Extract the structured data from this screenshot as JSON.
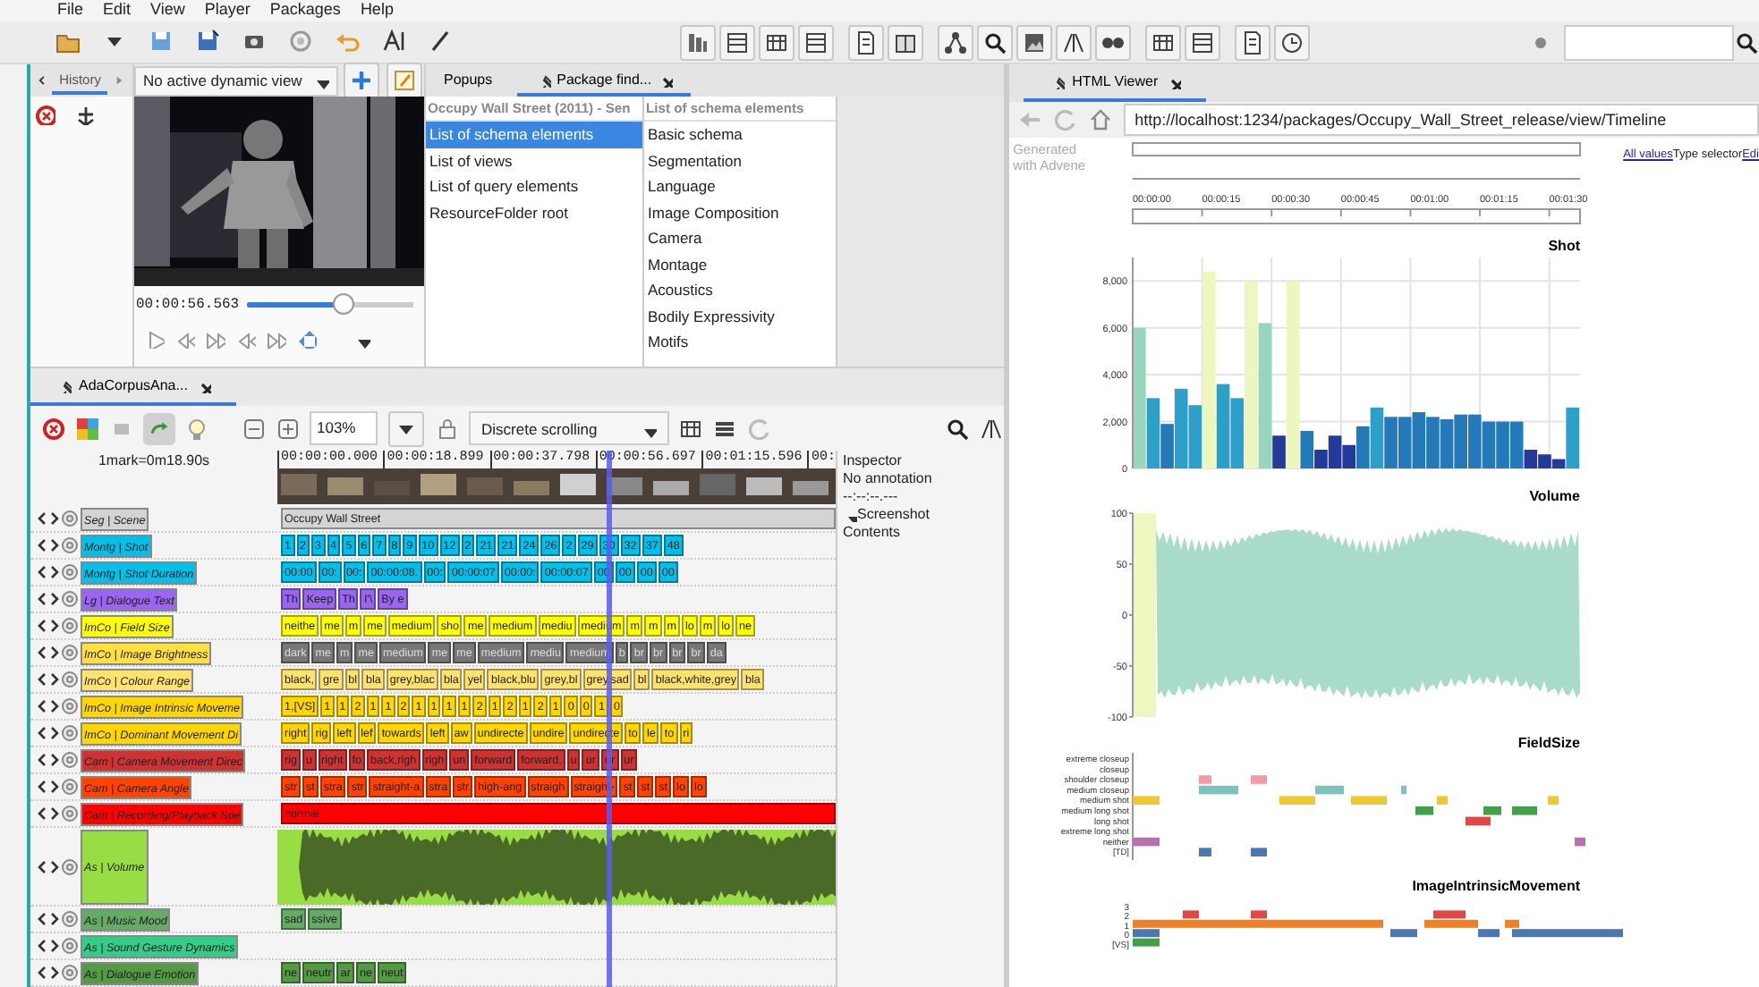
{
  "menu": [
    "File",
    "Edit",
    "View",
    "Player",
    "Packages",
    "Help"
  ],
  "history": {
    "tab": "History"
  },
  "video": {
    "view_selector": "No active dynamic view",
    "time": "00:00:56.563",
    "level": 0.6
  },
  "dock_tabs": [
    {
      "label": "Popups",
      "selected": false
    },
    {
      "label": "Package find...",
      "selected": true
    }
  ],
  "finder": {
    "columns": [
      {
        "header": "Occupy Wall Street (2011) - Sen",
        "items": [
          {
            "label": "List of schema elements",
            "selected": true
          },
          {
            "label": "List of views",
            "selected": false
          },
          {
            "label": "List of query elements",
            "selected": false
          },
          {
            "label": "ResourceFolder root",
            "selected": false
          }
        ]
      },
      {
        "header": "List of schema elements",
        "items": [
          {
            "label": "Basic schema",
            "selected": false
          },
          {
            "label": "Segmentation",
            "selected": false
          },
          {
            "label": "Language",
            "selected": false
          },
          {
            "label": "Image Composition",
            "selected": false
          },
          {
            "label": "Camera",
            "selected": false
          },
          {
            "label": "Montage",
            "selected": false
          },
          {
            "label": "Acoustics",
            "selected": false
          },
          {
            "label": "Bodily Expressivity",
            "selected": false
          },
          {
            "label": "Motifs",
            "selected": false
          }
        ]
      }
    ]
  },
  "timeline": {
    "tab": "AdaCorpusAna...",
    "zoom": "103%",
    "scroll_mode": "Discrete scrolling",
    "scale": "1mark=0m18.90s",
    "playhead": {
      "level": 0.59
    },
    "times": [
      "00:00:00.000",
      "00:00:18.899",
      "00:00:37.798",
      "00:00:56.697",
      "00:01:15.596",
      "00:"
    ],
    "inspector": {
      "title": "Inspector",
      "annotation": "No annotation",
      "time": "--:--:--.---",
      "section": "Screenshot",
      "contents": "Contents"
    },
    "tracks": [
      {
        "label": "Seg | Scene",
        "kind": "segments",
        "color": "#d4d4d4",
        "segments": [
          "Occupy Wall Street"
        ]
      },
      {
        "label": "Montg | Shot",
        "kind": "segments",
        "color": "#00bfe8",
        "segments": [
          "1",
          "2",
          "3",
          "4",
          "5",
          "6",
          "7",
          "8",
          "9",
          "10",
          "12",
          "2",
          "21",
          "21",
          "24",
          "26",
          "2",
          "29",
          "30",
          "32",
          "37",
          "48"
        ]
      },
      {
        "label": "Montg | Shot Duration",
        "kind": "segments",
        "color": "#00bfe8",
        "segments": [
          "00:00",
          "00:",
          "00:",
          "00:00:08.",
          "00:",
          "00:00:07",
          "00:00:",
          "00:00:07",
          "00",
          "00",
          "00",
          "00"
        ]
      },
      {
        "label": "Lg | Dialogue Text",
        "kind": "segments",
        "color": "#9966ee",
        "segments": [
          "Th",
          "Keep",
          "Th",
          "I'\\",
          "By e"
        ]
      },
      {
        "label": "ImCo | Field Size",
        "kind": "segments",
        "color": "#ffff00",
        "segments": [
          "neithe",
          "me",
          "m",
          "me",
          "medium",
          "sho",
          "me",
          "medium",
          "mediu",
          "medium",
          "m",
          "m",
          "m",
          "lo",
          "m",
          "lo",
          "ne"
        ]
      },
      {
        "label": "ImCo | Image Brightness",
        "kind": "dark_segments",
        "color": "#ffe040",
        "segments": [
          "dark",
          "me",
          "m",
          "me",
          "medium",
          "me",
          "me",
          "medium",
          "mediu",
          "medium",
          "b",
          "br",
          "br",
          "br",
          "br",
          "da"
        ]
      },
      {
        "label": "ImCo | Colour Range",
        "kind": "segments",
        "color": "#ffe270",
        "segments": [
          "black,",
          "gre",
          "bl",
          "bla",
          "grey,blac",
          "bla",
          "yel",
          "black,blu",
          "grey,bl",
          "grey,sad",
          "bl",
          "black,white,grey",
          "bla"
        ]
      },
      {
        "label": "ImCo | Image Intrinsic Moveme",
        "kind": "segments",
        "color": "#ffd700",
        "segments": [
          "1,[VS]",
          "1",
          "1",
          "2",
          "1",
          "1",
          "2",
          "1",
          "1",
          "1",
          "1",
          "2",
          "1",
          "2",
          "1",
          "2",
          "1",
          "0",
          "0",
          "1",
          "0"
        ]
      },
      {
        "label": "ImCo | Dominant Movement Di",
        "kind": "segments",
        "color": "#ffd700",
        "segments": [
          "right",
          "rig",
          "left",
          "lef",
          "towards",
          "left",
          "aw",
          "undirecte",
          "undire",
          "undirecte",
          "to",
          "le",
          "to",
          "ri"
        ]
      },
      {
        "label": "Cam | Camera Movement Direc",
        "kind": "segments",
        "color": "#cc3333",
        "segments": [
          "rig",
          "u",
          "right",
          "fo",
          "back,righ",
          "righ",
          "un",
          "forward",
          "forward,",
          "u",
          "ur",
          "ur",
          "ur"
        ]
      },
      {
        "label": "Cam | Camera Angle",
        "kind": "segments",
        "color": "#ff4400",
        "segments": [
          "str",
          "st",
          "stra",
          "str",
          "straight-a",
          "stra",
          "str",
          "high-ang",
          "straigh",
          "straight-",
          "st",
          "st",
          "st",
          "lo",
          "lo"
        ]
      },
      {
        "label": "Cam | Recording/Playback Spe",
        "kind": "segments",
        "color": "#ff0000",
        "segments": [
          "normal"
        ]
      },
      {
        "label": "As | Volume",
        "kind": "waveform",
        "color": "#99dd44"
      },
      {
        "label": "As | Music Mood",
        "kind": "segments",
        "color": "#66aa66",
        "segments": [
          "sad",
          "ssive"
        ]
      },
      {
        "label": "As | Sound Gesture Dynamics",
        "kind": "segments",
        "color": "#33cc88"
      },
      {
        "label": "As | Dialogue Emotion",
        "kind": "segments",
        "color": "#559944",
        "segments": [
          "ne",
          "neutr",
          "ar",
          "ne",
          "neut"
        ]
      }
    ]
  },
  "viewer": {
    "tab": "HTML Viewer",
    "url": "http://localhost:1234/packages/Occupy_Wall_Street_release/view/Timeline",
    "generated": "Generated with Advene",
    "links": [
      {
        "kind": "link",
        "text": "All values"
      },
      {
        "kind": "text",
        "text": "Type selector"
      },
      {
        "kind": "link",
        "text": "Edi"
      }
    ],
    "time_axis": [
      "00:00:00",
      "00:00:15",
      "00:00:30",
      "00:00:45",
      "00:01:00",
      "00:01:15",
      "00:01:30"
    ],
    "shot": {
      "chart_data": {
        "type": "bar",
        "title": "Shot",
        "values": [
          6000,
          3000,
          1900,
          3400,
          2700,
          8400,
          3600,
          3000,
          8000,
          6200,
          1400,
          8000,
          1600,
          800,
          1400,
          1000,
          1800,
          2600,
          2200,
          2200,
          2400,
          2200,
          2100,
          2300,
          2300,
          2000,
          2000,
          2000,
          800,
          600,
          400,
          2600
        ],
        "ylim": [
          0,
          9000
        ],
        "grid": true,
        "yticks": [
          {
            "value": 0,
            "label": "0"
          },
          {
            "value": 2000,
            "label": "2,000"
          },
          {
            "value": 4000,
            "label": "4,000"
          },
          {
            "value": 6000,
            "label": "6,000"
          },
          {
            "value": 8000,
            "label": "8,000"
          }
        ]
      }
    },
    "volume": {
      "title": "Volume",
      "ticks": [
        "100",
        "50",
        "0",
        "-50",
        "-100"
      ]
    },
    "field_size": {
      "title": "FieldSize",
      "labels": [
        "extreme closeup",
        "closeup",
        "shoulder closeup",
        "medium closeup",
        "medium shot",
        "medium long shot",
        "long shot",
        "extreme long shot",
        "neither",
        "[TD]"
      ]
    },
    "movement": {
      "title": "ImageIntrinsicMovement",
      "labels": [
        "3",
        "2",
        "1",
        "0",
        "[VS]"
      ]
    }
  }
}
